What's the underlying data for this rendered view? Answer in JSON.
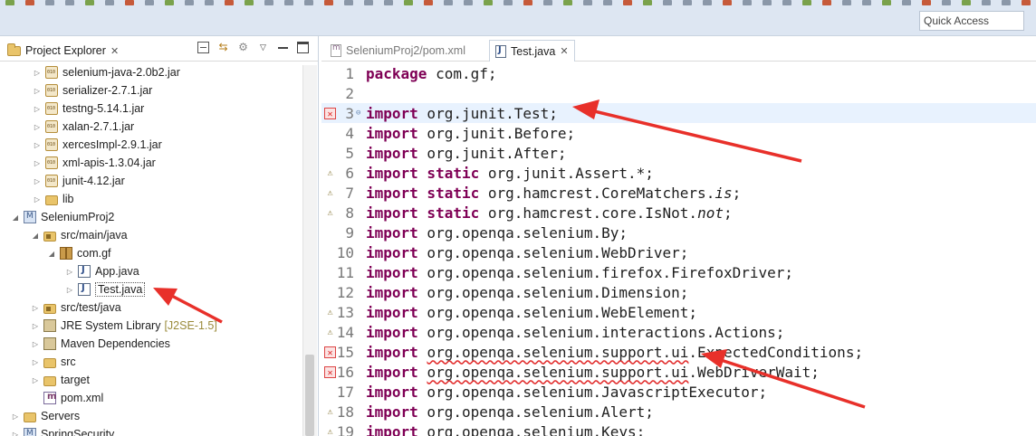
{
  "toolbar": {
    "quick_access_label": "Quick Access"
  },
  "explorer": {
    "tab_label": "Project Explorer",
    "tab_close": "✕",
    "tree": [
      {
        "label": "selenium-java-2.0b2.jar",
        "icon": "jar-icon",
        "twisty": "▷"
      },
      {
        "label": "serializer-2.7.1.jar",
        "icon": "jar-icon",
        "twisty": "▷"
      },
      {
        "label": "testng-5.14.1.jar",
        "icon": "jar-icon",
        "twisty": "▷"
      },
      {
        "label": "xalan-2.7.1.jar",
        "icon": "jar-icon",
        "twisty": "▷"
      },
      {
        "label": "xercesImpl-2.9.1.jar",
        "icon": "jar-icon",
        "twisty": "▷"
      },
      {
        "label": "xml-apis-1.3.04.jar",
        "icon": "jar-icon",
        "twisty": "▷"
      },
      {
        "label": "junit-4.12.jar",
        "icon": "jar-icon",
        "twisty": "▷"
      },
      {
        "label": "lib",
        "icon": "folder-icon",
        "twisty": "▷"
      },
      {
        "label": "SeleniumProj2",
        "icon": "maven-project-icon",
        "twisty": "◢"
      },
      {
        "label": "src/main/java",
        "icon": "source-folder-icon",
        "twisty": "◢"
      },
      {
        "label": "com.gf",
        "icon": "package-icon",
        "twisty": "◢"
      },
      {
        "label": "App.java",
        "icon": "java-file-icon",
        "twisty": "▷"
      },
      {
        "label": "Test.java",
        "icon": "java-file-icon",
        "twisty": "▷"
      },
      {
        "label": "src/test/java",
        "icon": "source-folder-icon",
        "twisty": "▷"
      },
      {
        "label": "JRE System Library",
        "decoration": "[J2SE-1.5]",
        "icon": "library-icon",
        "twisty": "▷"
      },
      {
        "label": "Maven Dependencies",
        "icon": "library-icon",
        "twisty": "▷"
      },
      {
        "label": "src",
        "icon": "folder-icon",
        "twisty": "▷"
      },
      {
        "label": "target",
        "icon": "folder-icon",
        "twisty": "▷"
      },
      {
        "label": "pom.xml",
        "icon": "xml-file-icon",
        "twisty": ""
      },
      {
        "label": "Servers",
        "icon": "folder-icon",
        "twisty": "▷"
      },
      {
        "label": "SpringSecurity",
        "icon": "maven-project-icon",
        "twisty": "▷"
      }
    ]
  },
  "editor": {
    "tabs": [
      {
        "label": "SeleniumProj2/pom.xml",
        "active": false
      },
      {
        "label": "Test.java",
        "active": true,
        "close": "✕"
      }
    ],
    "lines": [
      {
        "no": "1",
        "marker": "",
        "kw": "package",
        "rest": " com.gf;"
      },
      {
        "no": "2",
        "marker": "",
        "kw": "",
        "rest": ""
      },
      {
        "no": "3",
        "marker": "error",
        "kw": "import",
        "rest": " org.junit.Test;"
      },
      {
        "no": "4",
        "marker": "",
        "kw": "import",
        "rest": " org.junit.Before;"
      },
      {
        "no": "5",
        "marker": "",
        "kw": "import",
        "rest": " org.junit.After;"
      },
      {
        "no": "6",
        "marker": "warn",
        "kw": "import static",
        "rest": " org.junit.Assert.*;"
      },
      {
        "no": "7",
        "marker": "warn",
        "kw": "import static",
        "rest": " org.hamcrest.CoreMatchers.",
        "italic": "is",
        "tail": ";"
      },
      {
        "no": "8",
        "marker": "warn",
        "kw": "import static",
        "rest": " org.hamcrest.core.IsNot.",
        "italic": "not",
        "tail": ";"
      },
      {
        "no": "9",
        "marker": "",
        "kw": "import",
        "rest": " org.openqa.selenium.By;"
      },
      {
        "no": "10",
        "marker": "",
        "kw": "import",
        "rest": " org.openqa.selenium.WebDriver;"
      },
      {
        "no": "11",
        "marker": "",
        "kw": "import",
        "rest": " org.openqa.selenium.firefox.FirefoxDriver;"
      },
      {
        "no": "12",
        "marker": "",
        "kw": "import",
        "rest": " org.openqa.selenium.Dimension;"
      },
      {
        "no": "13",
        "marker": "warn",
        "kw": "import",
        "rest": " org.openqa.selenium.WebElement;"
      },
      {
        "no": "14",
        "marker": "warn",
        "kw": "import",
        "rest": " org.openqa.selenium.interactions.Actions;"
      },
      {
        "no": "15",
        "marker": "error-warn",
        "kw": "import",
        "rest": " ",
        "squiggle": "org.openqa.selenium.support.ui",
        "tail": ".ExpectedConditions;"
      },
      {
        "no": "16",
        "marker": "error-warn",
        "kw": "import",
        "rest": " ",
        "squiggle": "org.openqa.selenium.support.ui",
        "tail": ".WebDriverWait;"
      },
      {
        "no": "17",
        "marker": "",
        "kw": "import",
        "rest": " org.openqa.selenium.JavascriptExecutor;"
      },
      {
        "no": "18",
        "marker": "warn",
        "kw": "import",
        "rest": " org.openqa.selenium.Alert;"
      },
      {
        "no": "19",
        "marker": "warn",
        "kw": "import",
        "rest": " org.openqa.selenium.Keys;"
      }
    ]
  }
}
